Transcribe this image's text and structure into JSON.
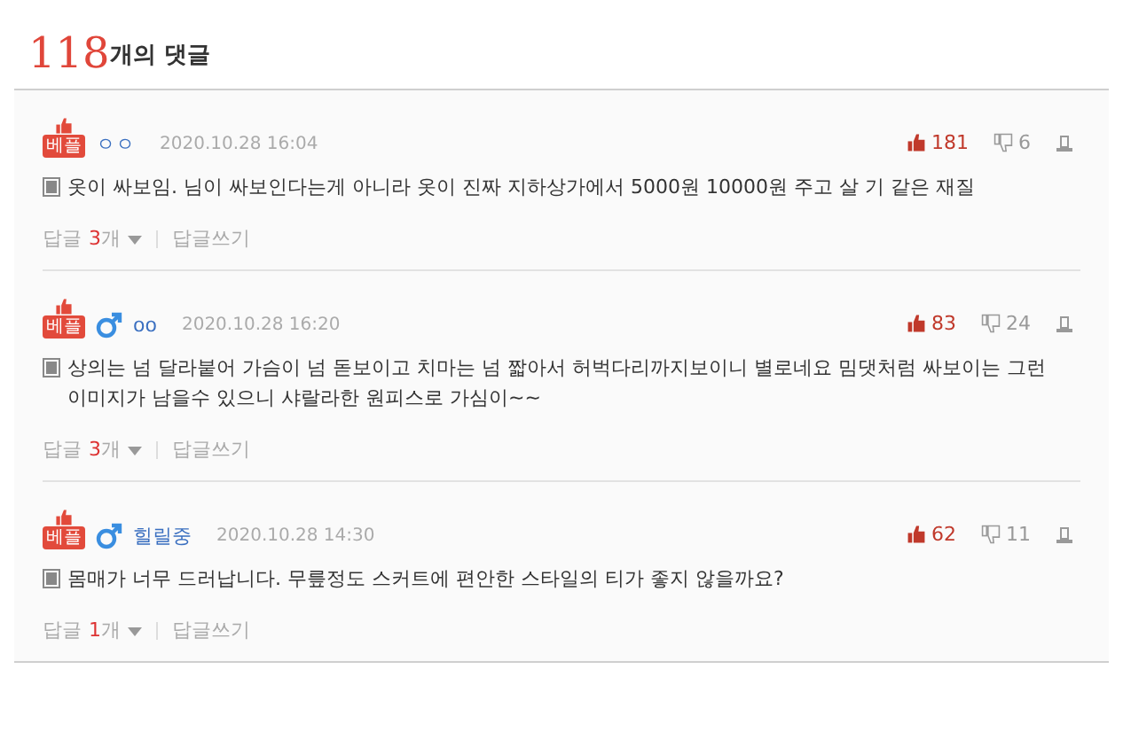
{
  "header": {
    "count": "118",
    "label": "개의 댓글"
  },
  "comments": [
    {
      "badge": "베플",
      "male_icon": false,
      "author": "ㅇㅇ",
      "date": "2020.10.28 16:04",
      "likes": "181",
      "dislikes": "6",
      "text": "옷이 싸보임. 님이 싸보인다는게 아니라 옷이 진짜 지하상가에서 5000원 10000원 주고 살 기 같은 재질",
      "reply_label": "답글",
      "reply_count": "3",
      "reply_unit": "개",
      "write_reply": "답글쓰기"
    },
    {
      "badge": "베플",
      "male_icon": true,
      "author": "oo",
      "date": "2020.10.28 16:20",
      "likes": "83",
      "dislikes": "24",
      "text": "상의는 넘 달라붙어 가슴이 넘 돋보이고 치마는 넘 짧아서 허벅다리까지보이니 별로네요 밈댓처럼 싸보이는 그런 이미지가 남을수 있으니 샤랄라한 원피스로 가심이~~",
      "reply_label": "답글",
      "reply_count": "3",
      "reply_unit": "개",
      "write_reply": "답글쓰기"
    },
    {
      "badge": "베플",
      "male_icon": true,
      "author": "힐릴중",
      "date": "2020.10.28 14:30",
      "likes": "62",
      "dislikes": "11",
      "text": "몸매가 너무 드러납니다. 무릎정도 스커트에 편안한 스타일의 티가 좋지 않을까요?",
      "reply_label": "답글",
      "reply_count": "1",
      "reply_unit": "개",
      "write_reply": "답글쓰기"
    }
  ]
}
